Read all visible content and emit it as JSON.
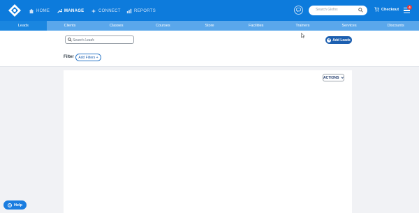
{
  "topnav": {
    "items": [
      {
        "label": "HOME",
        "icon": "home-icon"
      },
      {
        "label": "MANAGE",
        "icon": "wrench-icon"
      },
      {
        "label": "CONNECT",
        "icon": "sparkle-icon"
      },
      {
        "label": "REPORTS",
        "icon": "bar-chart-icon"
      }
    ],
    "active": "MANAGE",
    "search_placeholder": "Search Glofox",
    "checkout_label": "Checkout",
    "notification_count": "4"
  },
  "tabs": [
    {
      "label": "Leads",
      "active": true
    },
    {
      "label": "Clients",
      "active": false
    },
    {
      "label": "Classes",
      "active": false
    },
    {
      "label": "Courses",
      "active": false
    },
    {
      "label": "Store",
      "active": false
    },
    {
      "label": "Facilities",
      "active": false
    },
    {
      "label": "Trainers",
      "active": false
    },
    {
      "label": "Services",
      "active": false
    },
    {
      "label": "Discounts",
      "active": false
    }
  ],
  "toolbar": {
    "search_placeholder": "Search Leads",
    "add_leads_label": "Add Leads",
    "filter_label": "Filter",
    "add_filters_label": "Add Filters +"
  },
  "content": {
    "actions_label": "ACTIONS"
  },
  "help": {
    "label": "Help"
  },
  "colors": {
    "primary": "#0d7bdc",
    "tab_bar": "#5aa7eb",
    "button_dark": "#1c5fb0",
    "badge": "#e23b3b"
  }
}
